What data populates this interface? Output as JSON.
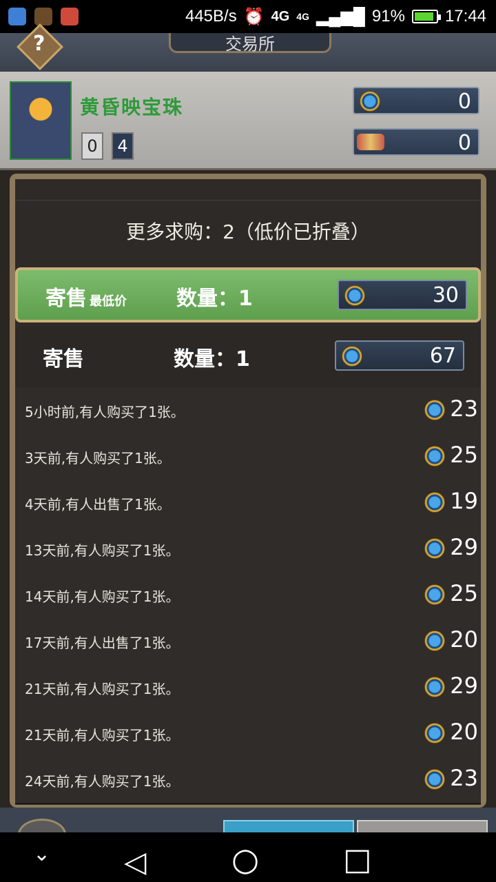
{
  "status_bar": {
    "net_speed": "445B/s",
    "signal_1": "4G",
    "signal_2": "4G",
    "battery_pct": "91%",
    "battery_level": 0.91,
    "time": "17:44"
  },
  "header": {
    "title": "交易所",
    "help_label": "?"
  },
  "card": {
    "name": "黄昏映宝珠",
    "owned_normal": "0",
    "owned_golden": "4"
  },
  "currency": {
    "gold": "0",
    "dust": "0"
  },
  "listing": {
    "more_buy_orders": "更多求购：2（低价已折叠）",
    "offers": [
      {
        "label": "寄售",
        "sub": "最低价",
        "qty": "数量：1",
        "price": "30"
      },
      {
        "label": "寄售",
        "sub": "",
        "qty": "数量：1",
        "price": "67"
      }
    ],
    "history": [
      {
        "text": "5小时前,有人购买了1张。",
        "price": "23"
      },
      {
        "text": "3天前,有人购买了1张。",
        "price": "25"
      },
      {
        "text": "4天前,有人出售了1张。",
        "price": "19"
      },
      {
        "text": "13天前,有人购买了1张。",
        "price": "29"
      },
      {
        "text": "14天前,有人购买了1张。",
        "price": "25"
      },
      {
        "text": "17天前,有人出售了1张。",
        "price": "20"
      },
      {
        "text": "21天前,有人购买了1张。",
        "price": "29"
      },
      {
        "text": "21天前,有人购买了1张。",
        "price": "20"
      },
      {
        "text": "24天前,有人购买了1张。",
        "price": "23"
      }
    ]
  },
  "nav": {
    "down": "⌄",
    "back": "◁",
    "home": "○",
    "recent": "□"
  }
}
